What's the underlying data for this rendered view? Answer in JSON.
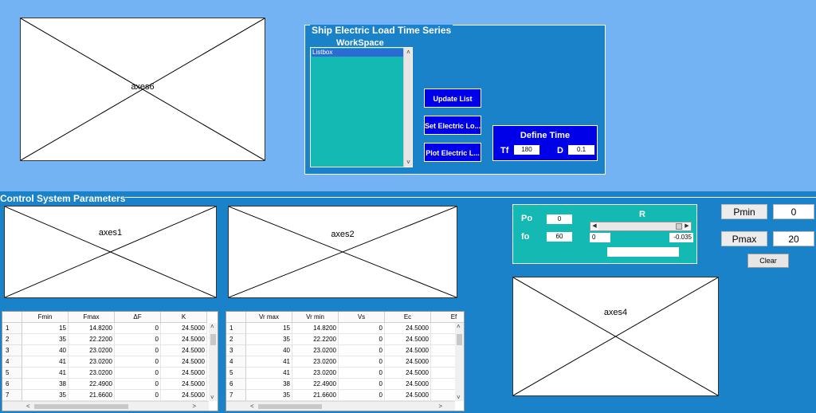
{
  "axes": {
    "axes6": "axes6",
    "axes1": "axes1",
    "axes2": "axes2",
    "axes4": "axes4"
  },
  "top_panel": {
    "title": "Ship Electric Load Time Series",
    "workspace_label": "WorkSpace",
    "listbox_item": "Listbox",
    "update_button": "Update List",
    "set_button": "Set  Electric Lo...",
    "plot_button": "Plot   Electric L...",
    "define_time": {
      "title": "Define Time",
      "tf_label": "Tf",
      "tf_value": "180",
      "d_label": "D",
      "d_value": "0.1"
    }
  },
  "bottom_panel": {
    "title": "Control System Parameters"
  },
  "table1": {
    "headers": [
      "Fmin",
      "Fmax",
      "ΔF",
      "K"
    ],
    "row_numbers": [
      "1",
      "2",
      "3",
      "4",
      "5",
      "6",
      "7"
    ],
    "rows": [
      [
        "15",
        "14.8200",
        "0",
        "24.5000"
      ],
      [
        "35",
        "22.2200",
        "0",
        "24.5000"
      ],
      [
        "40",
        "23.0200",
        "0",
        "24.5000"
      ],
      [
        "41",
        "23.0200",
        "0",
        "24.5000"
      ],
      [
        "41",
        "23.0200",
        "0",
        "24.5000"
      ],
      [
        "38",
        "22.4900",
        "0",
        "24.5000"
      ],
      [
        "35",
        "21.6600",
        "0",
        "24.5000"
      ]
    ]
  },
  "table2": {
    "headers": [
      "Vr max",
      "Vr min",
      "Vs",
      "Ec",
      "Ef"
    ],
    "row_numbers": [
      "1",
      "2",
      "3",
      "4",
      "5",
      "6",
      "7"
    ],
    "rows": [
      [
        "15",
        "14.8200",
        "0",
        "24.5000",
        ""
      ],
      [
        "35",
        "22.2200",
        "0",
        "24.5000",
        ""
      ],
      [
        "40",
        "23.0200",
        "0",
        "24.5000",
        ""
      ],
      [
        "41",
        "23.0200",
        "0",
        "24.5000",
        ""
      ],
      [
        "41",
        "23.0200",
        "0",
        "24.5000",
        ""
      ],
      [
        "38",
        "22.4900",
        "0",
        "24.5000",
        ""
      ],
      [
        "35",
        "21.6600",
        "0",
        "24.5000",
        ""
      ]
    ]
  },
  "control_panel": {
    "po_label": "Po",
    "po_value": "0",
    "fo_label": "fo",
    "fo_value": "60",
    "r_label": "R",
    "r_min": "0",
    "r_max": "-0.035"
  },
  "pmin": {
    "label": "Pmin",
    "value": "0"
  },
  "pmax": {
    "label": "Pmax",
    "value": "20"
  },
  "clear_button": "Clear",
  "scroll_glyphs": {
    "up": "˄",
    "down": "˅",
    "left": "<",
    "right": ">",
    "sl_left": "◀",
    "sl_right": "▶"
  }
}
